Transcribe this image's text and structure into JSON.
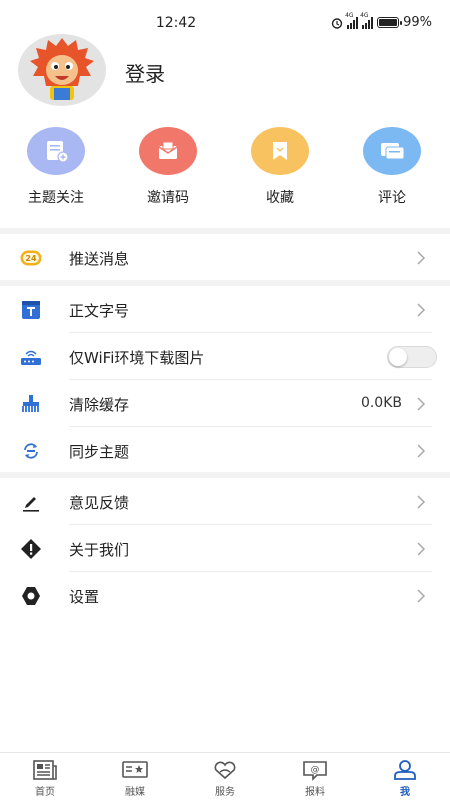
{
  "status_bar": {
    "time": "12:42",
    "network_label": "4G",
    "battery": "99%"
  },
  "profile": {
    "login_label": "登录",
    "avatar_icon": "cartoon-lion-avatar"
  },
  "quick_actions": [
    {
      "label": "主题关注",
      "icon": "topic-follow-icon",
      "color": "#a9b7f3"
    },
    {
      "label": "邀请码",
      "icon": "invite-code-icon",
      "color": "#f07769"
    },
    {
      "label": "收藏",
      "icon": "favorite-icon",
      "color": "#f8c261"
    },
    {
      "label": "评论",
      "icon": "comment-icon",
      "color": "#7cb9f2"
    }
  ],
  "settings": {
    "push": {
      "label": "推送消息",
      "badge": "24"
    },
    "font_size": {
      "label": "正文字号"
    },
    "wifi_images": {
      "label": "仅WiFi环境下载图片",
      "enabled": false
    },
    "clear_cache": {
      "label": "清除缓存",
      "value": "0.0KB"
    },
    "sync_topics": {
      "label": "同步主题"
    },
    "feedback": {
      "label": "意见反馈"
    },
    "about": {
      "label": "关于我们"
    },
    "settings": {
      "label": "设置"
    }
  },
  "tabbar": {
    "active": "我",
    "tabs": [
      {
        "label": "首页",
        "icon": "newspaper-icon"
      },
      {
        "label": "融媒",
        "icon": "media-icon"
      },
      {
        "label": "服务",
        "icon": "heart-hands-icon"
      },
      {
        "label": "报料",
        "icon": "report-chat-icon"
      },
      {
        "label": "我",
        "icon": "user-icon"
      }
    ]
  },
  "colors": {
    "accent": "#1f5fbf",
    "icon_blue": "#2f6fd6",
    "badge_yellow": "#f2b01e"
  }
}
